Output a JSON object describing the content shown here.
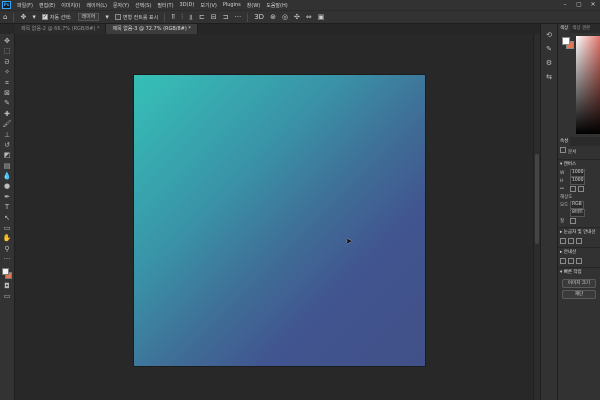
{
  "menu": {
    "logo": "Ps",
    "items": [
      "파일(F)",
      "편집(E)",
      "이미지(I)",
      "레이어(L)",
      "문자(Y)",
      "선택(S)",
      "필터(T)",
      "3D(D)",
      "보기(V)",
      "Plugins",
      "창(W)",
      "도움말(H)"
    ]
  },
  "options": {
    "auto_select_label": "자동 선택:",
    "auto_select_value": "레이어",
    "transform_label": "변형 컨트롤 표시"
  },
  "tabs": [
    {
      "label": "제목 없음-2 @ 66.7% (RGB/8#) *"
    },
    {
      "label": "제목 없음-3 @ 72.7% (RGB/8#) *"
    }
  ],
  "colors": {
    "foreground": "#f2f2f2",
    "background": "#e07856",
    "canvas_gradient": [
      "#36c0b7",
      "#3f6f97",
      "#415088"
    ]
  },
  "panels": {
    "color_tab": "색상",
    "swatch_tab": "색상 견본",
    "properties_tab": "속성",
    "properties_doc": "문서",
    "canvas_section": "캔버스",
    "w_label": "W",
    "h_label": "H",
    "w_value": "1000",
    "h_value": "1000",
    "resolution_label": "해상도",
    "mode_label": "모드",
    "mode_value": "RGB",
    "bits_value": "8비트",
    "fill_label": "칠",
    "rulers_section": "눈금자 및 안내선",
    "guides_section": "안내선",
    "quick_actions": "빠른 작업",
    "image_size_btn": "이미지 크기",
    "trim_btn": "재단"
  }
}
